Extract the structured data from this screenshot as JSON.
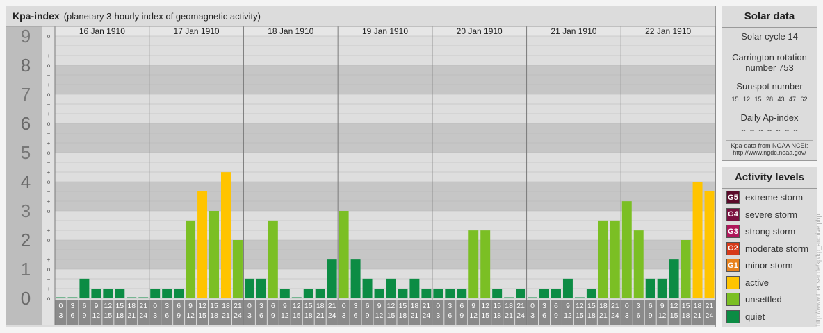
{
  "header": {
    "title": "Kpa-index",
    "subtitle": "(planetary 3-hourly index of geomagnetic activity)"
  },
  "chart_data": {
    "type": "bar",
    "ylim": [
      0,
      9
    ],
    "y_ticks": [
      "0",
      "1",
      "2",
      "3",
      "4",
      "5",
      "6",
      "7",
      "8",
      "9"
    ],
    "minor_ticks": [
      "o",
      "+",
      "−"
    ],
    "days": [
      "16 Jan 1910",
      "17 Jan 1910",
      "18 Jan 1910",
      "19 Jan 1910",
      "20 Jan 1910",
      "21 Jan 1910",
      "22 Jan 1910"
    ],
    "interval_labels": [
      [
        "0",
        "3"
      ],
      [
        "3",
        "6"
      ],
      [
        "6",
        "9"
      ],
      [
        "9",
        "12"
      ],
      [
        "12",
        "15"
      ],
      [
        "15",
        "18"
      ],
      [
        "18",
        "21"
      ],
      [
        "21",
        "24"
      ]
    ],
    "values": [
      [
        0,
        0,
        0.67,
        0.33,
        0.33,
        0.33,
        0,
        0
      ],
      [
        0.33,
        0.33,
        0.33,
        2.67,
        3.67,
        3.0,
        4.33,
        2.0
      ],
      [
        0.67,
        0.67,
        2.67,
        0.33,
        0,
        0.33,
        0.33,
        1.33
      ],
      [
        3.0,
        1.33,
        0.67,
        0.33,
        0.67,
        0.33,
        0.67,
        0.33
      ],
      [
        0.33,
        0.33,
        0.33,
        2.33,
        2.33,
        0.33,
        0,
        0.33
      ],
      [
        0,
        0.33,
        0.33,
        0.67,
        0,
        0.33,
        2.67,
        2.67
      ],
      [
        3.33,
        2.33,
        0.67,
        0.67,
        1.33,
        2.0,
        4.0,
        3.67
      ]
    ],
    "colors": {
      "quiet": "#0c8c44",
      "unsettled": "#7bbf24",
      "active": "#ffc400"
    }
  },
  "solar": {
    "title": "Solar data",
    "cycle": "Solar cycle 14",
    "carrington_1": "Carrington rotation",
    "carrington_2": "number 753",
    "sunspot_label": "Sunspot number",
    "sunspot_values": "15 12 15 28 43 47 62",
    "ap_label": "Daily Ap-index",
    "ap_values": "-- -- -- -- -- -- --",
    "source_1": "Kpa-data from NOAA NCEI:",
    "source_2": "http://www.ngdc.noaa.gov/"
  },
  "levels": {
    "title": "Activity levels",
    "items": [
      {
        "badge": "G5",
        "label": "extreme storm",
        "color": "#5a0a2a"
      },
      {
        "badge": "G4",
        "label": "severe storm",
        "color": "#7a1040"
      },
      {
        "badge": "G3",
        "label": "strong storm",
        "color": "#b0165a"
      },
      {
        "badge": "G2",
        "label": "moderate storm",
        "color": "#d63a1a"
      },
      {
        "badge": "G1",
        "label": "minor storm",
        "color": "#e8821e"
      },
      {
        "badge": "",
        "label": "active",
        "color": "#ffc400"
      },
      {
        "badge": "",
        "label": "unsettled",
        "color": "#7bbf24"
      },
      {
        "badge": "",
        "label": "quiet",
        "color": "#0c8c44"
      }
    ]
  },
  "credit": "http://www.theuser.de/kp/kp_archive.php"
}
